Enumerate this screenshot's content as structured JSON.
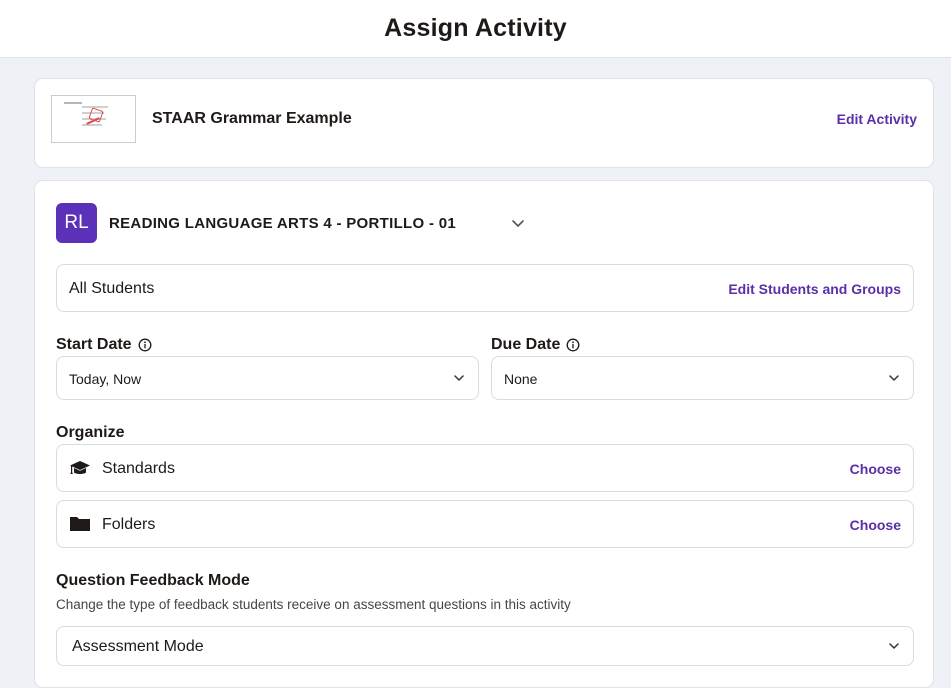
{
  "header": {
    "title": "Assign Activity"
  },
  "activity": {
    "title": "STAAR Grammar Example",
    "edit_label": "Edit Activity"
  },
  "class": {
    "avatar_initials": "RL",
    "avatar_color": "#5a31b8",
    "name": "READING LANGUAGE ARTS 4 - PORTILLO - 01"
  },
  "students": {
    "label": "All Students",
    "edit_label": "Edit Students and Groups"
  },
  "start_date": {
    "label": "Start Date",
    "value": "Today, Now"
  },
  "due_date": {
    "label": "Due Date",
    "value": "None"
  },
  "organize": {
    "label": "Organize",
    "items": [
      {
        "label": "Standards",
        "icon": "graduation-cap-icon",
        "action": "Choose"
      },
      {
        "label": "Folders",
        "icon": "folder-icon",
        "action": "Choose"
      }
    ]
  },
  "feedback": {
    "label": "Question Feedback Mode",
    "description": "Change the type of feedback students receive on assessment questions in this activity",
    "value": "Assessment Mode"
  },
  "colors": {
    "accent": "#5b2fa8",
    "background": "#eef1f5"
  }
}
